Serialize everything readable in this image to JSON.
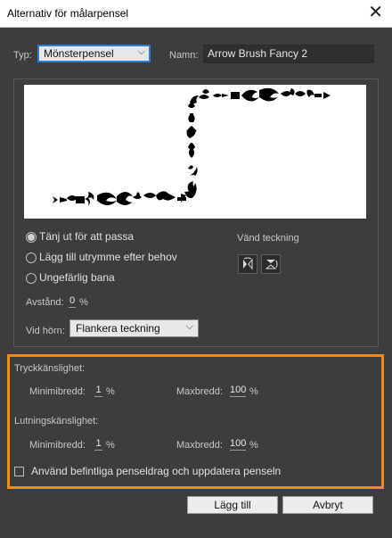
{
  "window": {
    "title": "Alternativ för målarpensel",
    "close_glyph": "✕"
  },
  "type": {
    "label": "Typ:",
    "value": "Mönsterpensel"
  },
  "name": {
    "label": "Namn:",
    "value": "Arrow Brush Fancy 2"
  },
  "fit_options": [
    {
      "label": "Tänj ut för att passa",
      "checked": true
    },
    {
      "label": "Lägg till utrymme efter behov",
      "checked": false
    },
    {
      "label": "Ungefärlig bana",
      "checked": false
    }
  ],
  "flip": {
    "label": "Vänd teckning",
    "icons": [
      "flip-along-icon",
      "flip-across-icon"
    ]
  },
  "spacing": {
    "label": "Avstånd:",
    "value": "0",
    "unit": "%"
  },
  "corner": {
    "label": "Vid hörn:",
    "value": "Flankera teckning"
  },
  "pressure": {
    "heading": "Tryckkänslighet:",
    "min_label": "Minimibredd:",
    "min_value": "1",
    "min_unit": "%",
    "max_label": "Maxbredd:",
    "max_value": "100",
    "max_unit": "%"
  },
  "tilt": {
    "heading": "Lutningskänslighet:",
    "min_label": "Minimibredd:",
    "min_value": "1",
    "min_unit": "%",
    "max_label": "Maxbredd:",
    "max_value": "100",
    "max_unit": "%"
  },
  "existing_strokes": {
    "label": "Använd befintliga penseldrag och uppdatera penseln",
    "checked": false
  },
  "buttons": {
    "add": "Lägg till",
    "cancel": "Avbryt"
  },
  "colors": {
    "highlight": "#f28b14",
    "focus": "#2a7fd4"
  }
}
